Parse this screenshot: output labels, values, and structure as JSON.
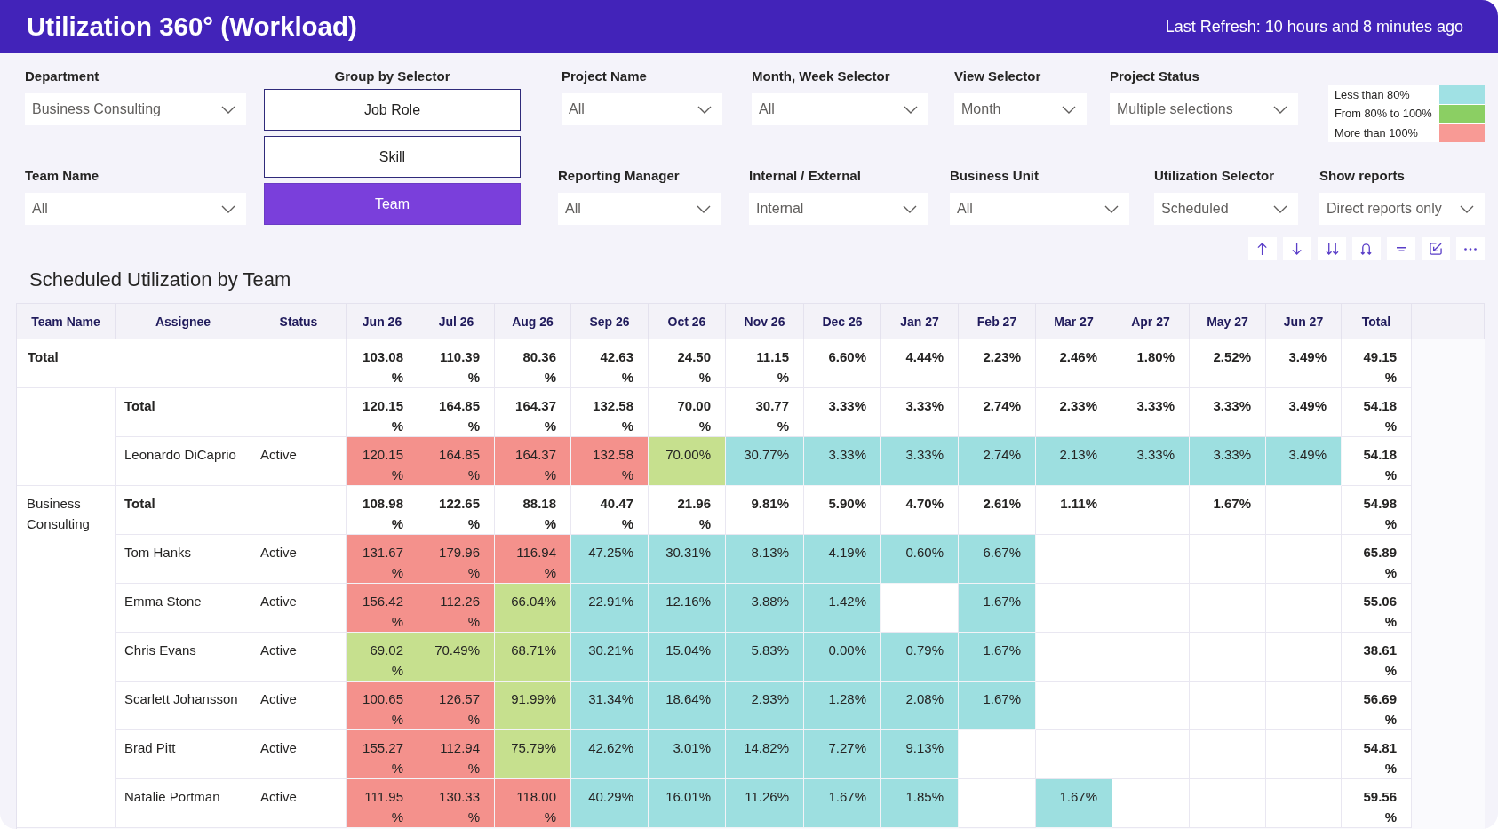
{
  "header": {
    "title": "Utilization 360° (Workload)",
    "last_refresh": "Last Refresh: 10 hours and 8 minutes ago"
  },
  "filters_left": [
    {
      "label": "Department",
      "value": "Business Consulting"
    },
    {
      "label": "Team Name",
      "value": "All"
    }
  ],
  "group_by_selector": {
    "label": "Group by Selector",
    "options": [
      {
        "label": "Job Role",
        "selected": false
      },
      {
        "label": "Skill",
        "selected": false
      },
      {
        "label": "Team",
        "selected": true
      }
    ]
  },
  "filters_row_1": [
    {
      "label": "Project Name",
      "value": "All"
    },
    {
      "label": "Month, Week Selector",
      "value": "All"
    },
    {
      "label": "View Selector",
      "value": "Month"
    },
    {
      "label": "Project Status",
      "value": "Multiple selections"
    }
  ],
  "legend": [
    {
      "label": "Less than 80%",
      "color": "#a0e1e4"
    },
    {
      "label": "From 80% to 100%",
      "color": "#8bcf63"
    },
    {
      "label": "More than 100%",
      "color": "#f89a95"
    }
  ],
  "filters_row_2": [
    {
      "label": "Reporting Manager",
      "value": "All"
    },
    {
      "label": "Internal / External",
      "value": "Internal"
    },
    {
      "label": "Business Unit",
      "value": "All"
    },
    {
      "label": "Utilization Selector",
      "value": "Scheduled"
    },
    {
      "label": "Show reports",
      "value": "Direct reports only"
    }
  ],
  "matrix": {
    "title": "Scheduled Utilization by Team",
    "columns": [
      "Team Name",
      "Assignee",
      "Status",
      "Jun 26",
      "Jul 26",
      "Aug 26",
      "Sep 26",
      "Oct 26",
      "Nov 26",
      "Dec 26",
      "Jan 27",
      "Feb 27",
      "Mar 27",
      "Apr 27",
      "May 27",
      "Jun 27",
      "Total"
    ],
    "grand_total": {
      "label": "Total",
      "values": [
        {
          "kind": "value",
          "value": "103.08%"
        },
        {
          "kind": "value",
          "value": "110.39%"
        },
        {
          "kind": "value",
          "value": "80.36%"
        },
        {
          "kind": "value",
          "value": "42.63%"
        },
        {
          "kind": "value",
          "value": "24.50%"
        },
        {
          "kind": "value",
          "value": "11.15%"
        },
        {
          "kind": "value",
          "value": "6.60%"
        },
        {
          "kind": "value",
          "value": "4.44%"
        },
        {
          "kind": "value",
          "value": "2.23%"
        },
        {
          "kind": "value",
          "value": "2.46%"
        },
        {
          "kind": "value",
          "value": "1.80%"
        },
        {
          "kind": "value",
          "value": "2.52%"
        },
        {
          "kind": "value",
          "value": "3.49%"
        },
        {
          "kind": "value",
          "value": "49.15%"
        }
      ]
    },
    "groups": [
      {
        "total": {
          "label": "Total",
          "values": [
            {
              "kind": "value",
              "value": "120.15%"
            },
            {
              "kind": "value",
              "value": "164.85%"
            },
            {
              "kind": "value",
              "value": "164.37%"
            },
            {
              "kind": "value",
              "value": "132.58%"
            },
            {
              "kind": "value",
              "value": "70.00%"
            },
            {
              "kind": "value",
              "value": "30.77%"
            },
            {
              "kind": "value",
              "value": "3.33%"
            },
            {
              "kind": "value",
              "value": "3.33%"
            },
            {
              "kind": "value",
              "value": "2.74%"
            },
            {
              "kind": "value",
              "value": "2.33%"
            },
            {
              "kind": "value",
              "value": "3.33%"
            },
            {
              "kind": "value",
              "value": "3.33%"
            },
            {
              "kind": "value",
              "value": "3.49%"
            },
            {
              "kind": "value",
              "value": "54.18%"
            }
          ]
        },
        "members": [
          {
            "assignee": "Leonardo DiCaprio",
            "status": "Active",
            "cells": [
              {
                "kind": "value",
                "value": "120.15%",
                "color": "#f4918c"
              },
              {
                "kind": "value",
                "value": "164.85%",
                "color": "#f4918c"
              },
              {
                "kind": "value",
                "value": "164.37%",
                "color": "#f4918c"
              },
              {
                "kind": "value",
                "value": "132.58%",
                "color": "#f4918c"
              },
              {
                "kind": "value",
                "value": "70.00%",
                "color": "#c6e08e"
              },
              {
                "kind": "value",
                "value": "30.77%",
                "color": "#9ddfe0"
              },
              {
                "kind": "value",
                "value": "3.33%",
                "color": "#9ddfe0"
              },
              {
                "kind": "value",
                "value": "3.33%",
                "color": "#9ddfe0"
              },
              {
                "kind": "value",
                "value": "2.74%",
                "color": "#9ddfe0"
              },
              {
                "kind": "value",
                "value": "2.13%",
                "color": "#9ddfe0"
              },
              {
                "kind": "value",
                "value": "3.33%",
                "color": "#9ddfe0"
              },
              {
                "kind": "value",
                "value": "3.33%",
                "color": "#9ddfe0"
              },
              {
                "kind": "value",
                "value": "3.49%",
                "color": "#9ddfe0"
              }
            ],
            "total": "54.18%"
          }
        ]
      },
      {
        "team": "Business Consulting",
        "total": {
          "label": "Total",
          "values": [
            {
              "kind": "value",
              "value": "108.98%"
            },
            {
              "kind": "value",
              "value": "122.65%"
            },
            {
              "kind": "value",
              "value": "88.18%"
            },
            {
              "kind": "value",
              "value": "40.47%"
            },
            {
              "kind": "value",
              "value": "21.96%"
            },
            {
              "kind": "value",
              "value": "9.81%"
            },
            {
              "kind": "value",
              "value": "5.90%"
            },
            {
              "kind": "value",
              "value": "4.70%"
            },
            {
              "kind": "value",
              "value": "2.61%"
            },
            {
              "kind": "value",
              "value": "1.11%"
            },
            {
              "kind": "blank"
            },
            {
              "kind": "value",
              "value": "1.67%"
            },
            {
              "kind": "blank"
            },
            {
              "kind": "value",
              "value": "54.98%"
            }
          ]
        },
        "members": [
          {
            "assignee": "Tom Hanks",
            "status": "Active",
            "cells": [
              {
                "kind": "value",
                "value": "131.67%",
                "color": "#f4918c"
              },
              {
                "kind": "value",
                "value": "179.96%",
                "color": "#f4918c"
              },
              {
                "kind": "value",
                "value": "116.94%",
                "color": "#f4918c"
              },
              {
                "kind": "value",
                "value": "47.25%",
                "color": "#9ddfe0"
              },
              {
                "kind": "value",
                "value": "30.31%",
                "color": "#9ddfe0"
              },
              {
                "kind": "value",
                "value": "8.13%",
                "color": "#9ddfe0"
              },
              {
                "kind": "value",
                "value": "4.19%",
                "color": "#9ddfe0"
              },
              {
                "kind": "value",
                "value": "0.60%",
                "color": "#9ddfe0"
              },
              {
                "kind": "value",
                "value": "6.67%",
                "color": "#9ddfe0"
              },
              {
                "kind": "blank"
              },
              {
                "kind": "blank"
              },
              {
                "kind": "blank"
              },
              {
                "kind": "blank"
              }
            ],
            "total": "65.89%"
          },
          {
            "assignee": "Emma Stone",
            "status": "Active",
            "cells": [
              {
                "kind": "value",
                "value": "156.42%",
                "color": "#f4918c"
              },
              {
                "kind": "value",
                "value": "112.26%",
                "color": "#f4918c"
              },
              {
                "kind": "value",
                "value": "66.04%",
                "color": "#c6e08e"
              },
              {
                "kind": "value",
                "value": "22.91%",
                "color": "#9ddfe0"
              },
              {
                "kind": "value",
                "value": "12.16%",
                "color": "#9ddfe0"
              },
              {
                "kind": "value",
                "value": "3.88%",
                "color": "#9ddfe0"
              },
              {
                "kind": "value",
                "value": "1.42%",
                "color": "#9ddfe0"
              },
              {
                "kind": "blank"
              },
              {
                "kind": "value",
                "value": "1.67%",
                "color": "#9ddfe0"
              },
              {
                "kind": "blank"
              },
              {
                "kind": "blank"
              },
              {
                "kind": "blank"
              },
              {
                "kind": "blank"
              }
            ],
            "total": "55.06%"
          },
          {
            "assignee": "Chris Evans",
            "status": "Active",
            "cells": [
              {
                "kind": "value",
                "value": "69.02%",
                "color": "#c6e08e"
              },
              {
                "kind": "value",
                "value": "70.49%",
                "color": "#c6e08e"
              },
              {
                "kind": "value",
                "value": "68.71%",
                "color": "#c6e08e"
              },
              {
                "kind": "value",
                "value": "30.21%",
                "color": "#9ddfe0"
              },
              {
                "kind": "value",
                "value": "15.04%",
                "color": "#9ddfe0"
              },
              {
                "kind": "value",
                "value": "5.83%",
                "color": "#9ddfe0"
              },
              {
                "kind": "value",
                "value": "0.00%",
                "color": "#9ddfe0"
              },
              {
                "kind": "value",
                "value": "0.79%",
                "color": "#9ddfe0"
              },
              {
                "kind": "value",
                "value": "1.67%",
                "color": "#9ddfe0"
              },
              {
                "kind": "blank"
              },
              {
                "kind": "blank"
              },
              {
                "kind": "blank"
              },
              {
                "kind": "blank"
              }
            ],
            "total": "38.61%"
          },
          {
            "assignee": "Scarlett Johansson",
            "status": "Active",
            "cells": [
              {
                "kind": "value",
                "value": "100.65%",
                "color": "#f4918c"
              },
              {
                "kind": "value",
                "value": "126.57%",
                "color": "#f4918c"
              },
              {
                "kind": "value",
                "value": "91.99%",
                "color": "#c6e08e"
              },
              {
                "kind": "value",
                "value": "31.34%",
                "color": "#9ddfe0"
              },
              {
                "kind": "value",
                "value": "18.64%",
                "color": "#9ddfe0"
              },
              {
                "kind": "value",
                "value": "2.93%",
                "color": "#9ddfe0"
              },
              {
                "kind": "value",
                "value": "1.28%",
                "color": "#9ddfe0"
              },
              {
                "kind": "value",
                "value": "2.08%",
                "color": "#9ddfe0"
              },
              {
                "kind": "value",
                "value": "1.67%",
                "color": "#9ddfe0"
              },
              {
                "kind": "blank"
              },
              {
                "kind": "blank"
              },
              {
                "kind": "blank"
              },
              {
                "kind": "blank"
              }
            ],
            "total": "56.69%"
          },
          {
            "assignee": "Brad Pitt",
            "status": "Active",
            "cells": [
              {
                "kind": "value",
                "value": "155.27%",
                "color": "#f4918c"
              },
              {
                "kind": "value",
                "value": "112.94%",
                "color": "#f4918c"
              },
              {
                "kind": "value",
                "value": "75.79%",
                "color": "#c6e08e"
              },
              {
                "kind": "value",
                "value": "42.62%",
                "color": "#9ddfe0"
              },
              {
                "kind": "value",
                "value": "3.01%",
                "color": "#9ddfe0"
              },
              {
                "kind": "value",
                "value": "14.82%",
                "color": "#9ddfe0"
              },
              {
                "kind": "value",
                "value": "7.27%",
                "color": "#9ddfe0"
              },
              {
                "kind": "value",
                "value": "9.13%",
                "color": "#9ddfe0"
              },
              {
                "kind": "blank"
              },
              {
                "kind": "blank"
              },
              {
                "kind": "blank"
              },
              {
                "kind": "blank"
              },
              {
                "kind": "blank"
              }
            ],
            "total": "54.81%"
          },
          {
            "assignee": "Natalie Portman",
            "status": "Active",
            "cells": [
              {
                "kind": "value",
                "value": "111.95%",
                "color": "#f4918c"
              },
              {
                "kind": "value",
                "value": "130.33%",
                "color": "#f4918c"
              },
              {
                "kind": "value",
                "value": "118.00%",
                "color": "#f4918c"
              },
              {
                "kind": "value",
                "value": "40.29%",
                "color": "#9ddfe0"
              },
              {
                "kind": "value",
                "value": "16.01%",
                "color": "#9ddfe0"
              },
              {
                "kind": "value",
                "value": "11.26%",
                "color": "#9ddfe0"
              },
              {
                "kind": "value",
                "value": "1.67%",
                "color": "#9ddfe0"
              },
              {
                "kind": "value",
                "value": "1.85%",
                "color": "#9ddfe0"
              },
              {
                "kind": "blank"
              },
              {
                "kind": "value",
                "value": "1.67%",
                "color": "#9ddfe0"
              },
              {
                "kind": "blank"
              },
              {
                "kind": "blank"
              },
              {
                "kind": "blank"
              }
            ],
            "total": "59.56%"
          }
        ]
      }
    ]
  }
}
